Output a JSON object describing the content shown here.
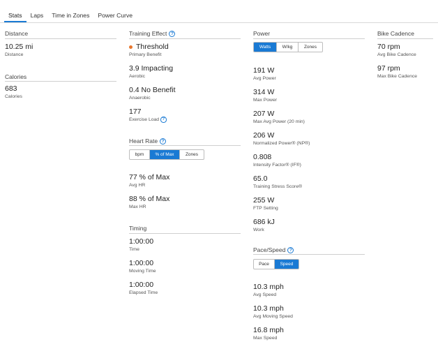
{
  "tabs": [
    {
      "label": "Stats",
      "active": true
    },
    {
      "label": "Laps"
    },
    {
      "label": "Time in Zones"
    },
    {
      "label": "Power Curve"
    }
  ],
  "distance": {
    "title": "Distance",
    "value": "10.25 mi",
    "label": "Distance"
  },
  "calories": {
    "title": "Calories",
    "value": "683",
    "label": "Calories"
  },
  "training_effect": {
    "title": "Training Effect",
    "primary": {
      "value": "Threshold",
      "label": "Primary Benefit",
      "dot_color": "#e8772e"
    },
    "aerobic": {
      "value": "3.9 Impacting",
      "label": "Aerobic"
    },
    "anaerobic": {
      "value": "0.4 No Benefit",
      "label": "Anaerobic"
    },
    "exercise_load": {
      "value": "177",
      "label": "Exercise Load"
    }
  },
  "heart_rate": {
    "title": "Heart Rate",
    "toggle": [
      "bpm",
      "% of Max",
      "Zones"
    ],
    "avg": {
      "value": "77 % of Max",
      "label": "Avg HR"
    },
    "max": {
      "value": "88 % of Max",
      "label": "Max HR"
    }
  },
  "timing": {
    "title": "Timing",
    "time": {
      "value": "1:00:00",
      "label": "Time"
    },
    "moving": {
      "value": "1:00:00",
      "label": "Moving Time"
    },
    "elapsed": {
      "value": "1:00:00",
      "label": "Elapsed Time"
    }
  },
  "power": {
    "title": "Power",
    "toggle": [
      "Watts",
      "W/kg",
      "Zones"
    ],
    "avg": {
      "value": "191 W",
      "label": "Avg Power"
    },
    "max": {
      "value": "314 W",
      "label": "Max Power"
    },
    "max_avg20": {
      "value": "207 W",
      "label": "Max Avg Power (20 min)"
    },
    "np": {
      "value": "206 W",
      "label": "Normalized Power® (NP®)"
    },
    "if": {
      "value": "0.808",
      "label": "Intensity Factor® (IF®)"
    },
    "tss": {
      "value": "65.0",
      "label": "Training Stress Score®"
    },
    "ftp": {
      "value": "255 W",
      "label": "FTP Setting"
    },
    "work": {
      "value": "686 kJ",
      "label": "Work"
    }
  },
  "pace_speed": {
    "title": "Pace/Speed",
    "toggle": [
      "Pace",
      "Speed"
    ],
    "avg": {
      "value": "10.3 mph",
      "label": "Avg Speed"
    },
    "avg_moving": {
      "value": "10.3 mph",
      "label": "Avg Moving Speed"
    },
    "max": {
      "value": "16.8 mph",
      "label": "Max Speed"
    }
  },
  "bike_cadence": {
    "title": "Bike Cadence",
    "avg": {
      "value": "70 rpm",
      "label": "Avg Bike Cadence"
    },
    "max": {
      "value": "97 rpm",
      "label": "Max Bike Cadence"
    }
  },
  "colors": {
    "accent": "#1a7ad4",
    "threshold_dot": "#e8772e"
  }
}
